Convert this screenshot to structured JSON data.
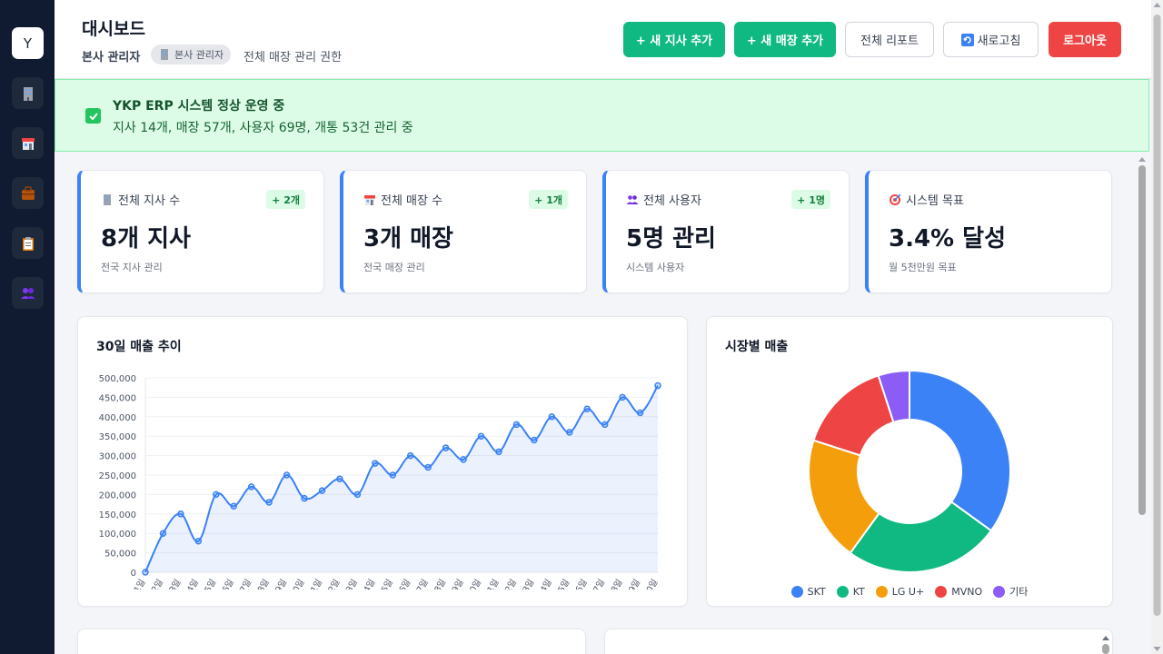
{
  "sidebar": {
    "logo": "Y",
    "items": [
      {
        "icon": "building-icon"
      },
      {
        "icon": "store-icon"
      },
      {
        "icon": "briefcase-icon"
      },
      {
        "icon": "clipboard-icon"
      },
      {
        "icon": "users-icon"
      }
    ]
  },
  "header": {
    "title": "대시보드",
    "role_label": "본사 관리자",
    "role_badge": "본사 관리자",
    "role_desc": "전체 매장 관리 권한",
    "buttons": {
      "add_branch": "+ 새 지사 추가",
      "add_store": "+ 새 매장 추가",
      "report": "전체 리포트",
      "refresh": "새로고침",
      "logout": "로그아웃"
    }
  },
  "alert": {
    "title": "YKP ERP 시스템 정상 운영 중",
    "desc": "지사 14개, 매장 57개, 사용자 69명, 개통 53건 관리 중"
  },
  "stats": [
    {
      "icon": "building-icon",
      "label": "전체 지사 수",
      "badge": "+ 2개",
      "value": "8개 지사",
      "sub": "전국 지사 관리"
    },
    {
      "icon": "store-icon",
      "label": "전체 매장 수",
      "badge": "+ 1개",
      "value": "3개 매장",
      "sub": "전국 매장 관리"
    },
    {
      "icon": "users-icon",
      "label": "전체 사용자",
      "badge": "+ 1명",
      "value": "5명 관리",
      "sub": "시스템 사용자"
    },
    {
      "icon": "target-icon",
      "label": "시스템 목표",
      "badge": "",
      "value": "3.4% 달성",
      "sub": "월 5천만원 목표"
    }
  ],
  "colors": {
    "primary": "#3b82f6",
    "success": "#10b981",
    "danger": "#ef4444",
    "sidebar": "#101a30"
  },
  "chart_data": [
    {
      "type": "line",
      "title": "30일 매출 추이",
      "x": [
        "1일",
        "2일",
        "3일",
        "4일",
        "5일",
        "6일",
        "7일",
        "8일",
        "9일",
        "10일",
        "11일",
        "12일",
        "13일",
        "14일",
        "15일",
        "16일",
        "17일",
        "18일",
        "19일",
        "20일",
        "21일",
        "22일",
        "23일",
        "24일",
        "25일",
        "26일",
        "27일",
        "28일",
        "29일",
        "30일"
      ],
      "values": [
        0,
        100000,
        150000,
        80000,
        200000,
        170000,
        220000,
        180000,
        250000,
        190000,
        210000,
        240000,
        200000,
        280000,
        250000,
        300000,
        270000,
        320000,
        290000,
        350000,
        310000,
        380000,
        340000,
        400000,
        360000,
        420000,
        380000,
        450000,
        410000,
        480000
      ],
      "ylim": [
        0,
        500000
      ],
      "yticks": [
        "500,000",
        "450,000",
        "400,000",
        "350,000",
        "300,000",
        "250,000",
        "200,000",
        "150,000",
        "100,000",
        "50,000",
        "0"
      ],
      "grid": true,
      "color": "#3b82f6"
    },
    {
      "type": "pie",
      "title": "시장별 매출",
      "categories": [
        "SKT",
        "KT",
        "LG U+",
        "MVNO",
        "기타"
      ],
      "values": [
        35,
        25,
        20,
        15,
        5
      ],
      "colors": [
        "#3b82f6",
        "#10b981",
        "#f59e0b",
        "#ef4444",
        "#8b5cf6"
      ],
      "legend": "bottom"
    }
  ]
}
